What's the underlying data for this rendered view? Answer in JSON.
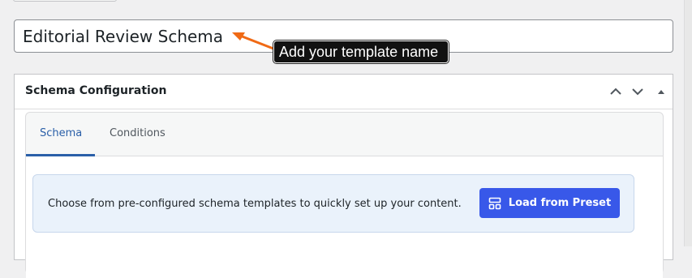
{
  "post_title": {
    "value": "Editorial Review Schema"
  },
  "callout": {
    "text": "Add your template name",
    "arrow_color": "#f06a15"
  },
  "metabox": {
    "title": "Schema Configuration",
    "controls": [
      "chevron-up-icon",
      "chevron-down-icon",
      "triangle-up-icon"
    ]
  },
  "tabs": [
    {
      "label": "Schema",
      "active": true
    },
    {
      "label": "Conditions",
      "active": false
    }
  ],
  "preset": {
    "description": "Choose from pre-configured schema templates to quickly set up your content.",
    "button_label": "Load from Preset",
    "button_icon": "layout-icon"
  },
  "colors": {
    "accent": "#2a5fa8",
    "button_bg": "#3858e9",
    "notice_bg": "#eaf2fb"
  }
}
